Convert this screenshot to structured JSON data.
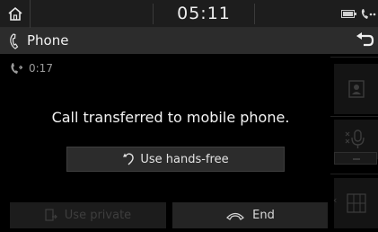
{
  "status_bar": {
    "clock": "05:11",
    "icons": [
      "home-icon",
      "battery-icon",
      "phone-signal-icon"
    ]
  },
  "title_bar": {
    "title": "Phone",
    "icons": [
      "phone-icon",
      "back-icon"
    ]
  },
  "call": {
    "duration": "0:17",
    "message": "Call transferred to mobile phone."
  },
  "buttons": {
    "hands_free": "Use hands-free",
    "private": "Use private",
    "end": "End"
  },
  "side_buttons": [
    "contacts-icon",
    "mute-mic-icon",
    "keypad-icon"
  ],
  "colors": {
    "background": "#000000",
    "status_bar": "#1d1d1d",
    "title_bar": "#2c2c2c",
    "button": "#2c2c2c",
    "disabled_text": "#3e3e3e"
  }
}
